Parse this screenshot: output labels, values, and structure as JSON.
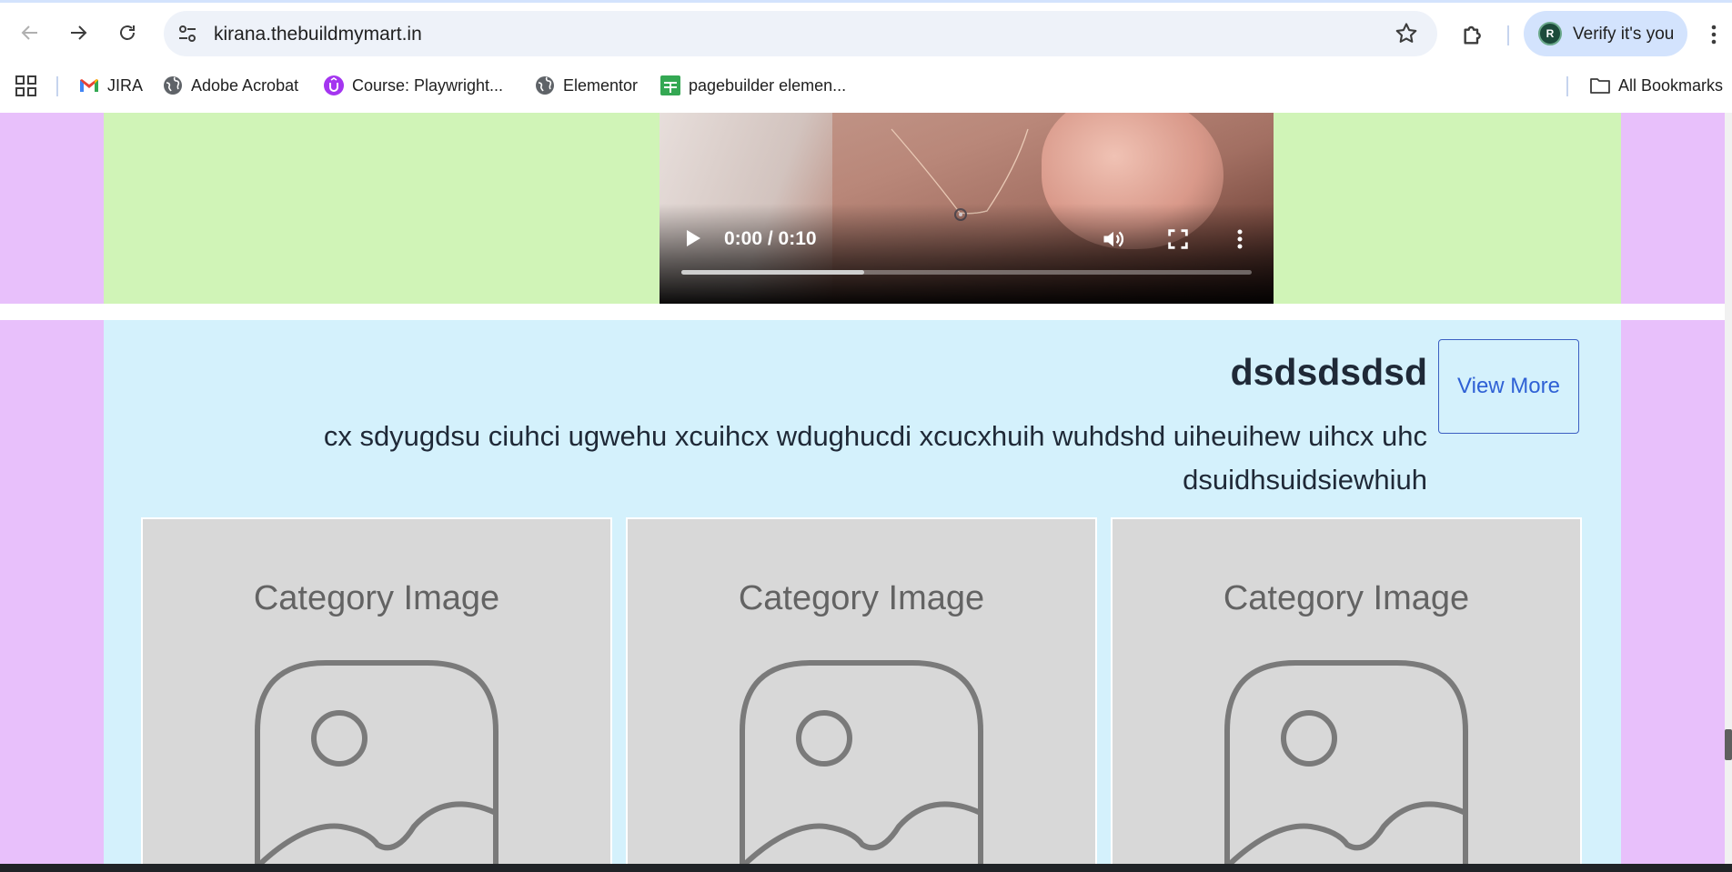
{
  "browser": {
    "url": "kirana.thebuildmymart.in",
    "profile_initial": "R",
    "verify_label": "Verify it's you",
    "icons": [
      "back-arrow-icon",
      "forward-arrow-icon",
      "reload-icon",
      "site-settings-icon",
      "bookmark-star-icon",
      "extensions-puzzle-icon",
      "kebab-menu-icon"
    ],
    "bookmarks": [
      {
        "label": "JIRA",
        "icon": "gmail-icon"
      },
      {
        "label": "Adobe Acrobat",
        "icon": "globe-icon"
      },
      {
        "label": "Course: Playwright...",
        "icon": "udemy-icon"
      },
      {
        "label": "Elementor",
        "icon": "globe-icon"
      },
      {
        "label": "pagebuilder elemen...",
        "icon": "sheets-icon"
      }
    ],
    "all_bookmarks_label": "All Bookmarks"
  },
  "video": {
    "time": "0:00 / 0:10",
    "progress_fraction": 0.32
  },
  "category_section": {
    "title": "dsdsdsdsd",
    "description": "cx sdyugdsu ciuhci ugwehu xcuihcx wdughucdi xcucxhuih wuhdshd uiheuihew uihcx uhc dsuidhsuidsiewhiuh",
    "view_more_label": "View More",
    "cards": [
      {
        "label": "Category Image"
      },
      {
        "label": "Category Image"
      },
      {
        "label": "Category Image"
      }
    ]
  },
  "colors": {
    "outer_bg": "#e8c0fb",
    "video_section_bg": "#d0f4b7",
    "category_section_bg": "#d4f1fc",
    "card_bg": "#d8d8d8",
    "button_text": "#2f61d5"
  }
}
